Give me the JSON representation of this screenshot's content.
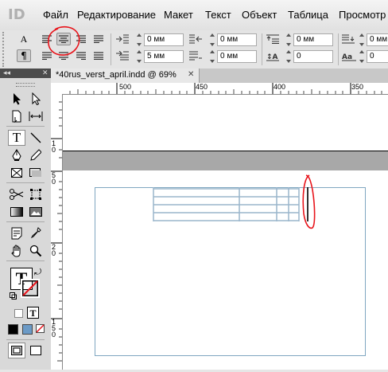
{
  "app": {
    "logo": "ID"
  },
  "menu": [
    "Файл",
    "Редактирование",
    "Макет",
    "Текст",
    "Объект",
    "Таблица",
    "Просмотр"
  ],
  "control_panel": {
    "char_mode_label": "A",
    "para_mode_label": "¶",
    "left_indent": "0 мм",
    "right_indent": "0 мм",
    "first_line_indent": "5 мм",
    "last_line_indent": "0 мм",
    "space_before": "0 мм",
    "space_after": "0",
    "drop_cap_lines": "0 мм",
    "drop_cap_chars": "0",
    "selected_alignment": "align-center"
  },
  "document": {
    "tab_title": "*40rus_verst_april.indd @ 69%",
    "hruler_labels": [
      "500",
      "450",
      "400",
      "350"
    ],
    "vruler_labels": [
      "1\n0",
      "5\n0",
      "2\n0",
      "1\n5\n0"
    ]
  },
  "tools": {
    "type_tool_glyph": "T",
    "fill_stroke_glyph": "T"
  },
  "colors": {
    "annotation": "#e8141b",
    "frame": "#7fa6c0",
    "table_line": "#9ab6cc"
  }
}
